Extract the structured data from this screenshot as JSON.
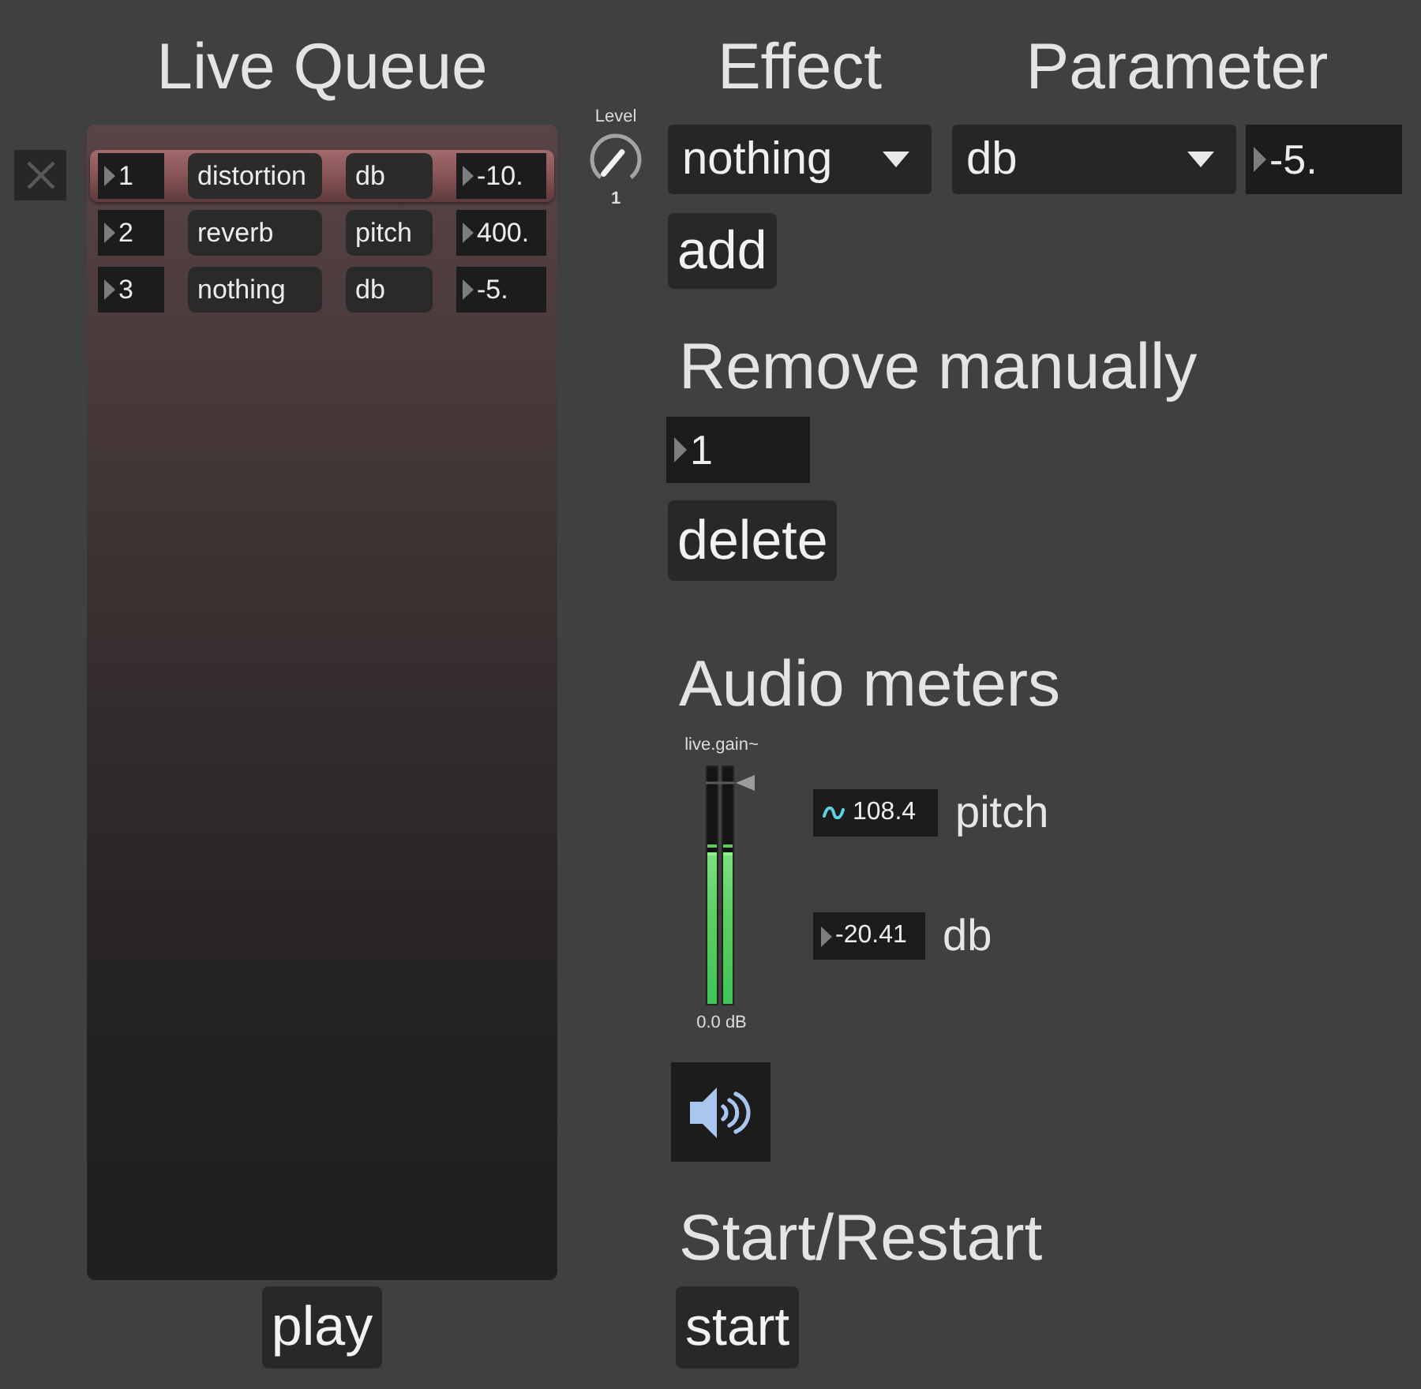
{
  "queue": {
    "title": "Live Queue",
    "rows": [
      {
        "index": "1",
        "effect": "distortion",
        "parameter": "db",
        "value": "-10.",
        "selected": true
      },
      {
        "index": "2",
        "effect": "reverb",
        "parameter": "pitch",
        "value": "400.",
        "selected": false
      },
      {
        "index": "3",
        "effect": "nothing",
        "parameter": "db",
        "value": "-5.",
        "selected": false
      }
    ],
    "play_button": "play"
  },
  "level_dial": {
    "label": "Level",
    "value": "1"
  },
  "add_effect": {
    "effect_heading": "Effect",
    "parameter_heading": "Parameter",
    "effect": "nothing",
    "parameter": "db",
    "value": "-5.",
    "button": "add"
  },
  "remove": {
    "heading": "Remove manually",
    "index": "1",
    "button": "delete"
  },
  "audio_meters": {
    "heading": "Audio meters",
    "gain": {
      "label": "live.gain~",
      "reading": "0.0 dB",
      "level": 0.93,
      "channels": [
        {
          "level": 0.64
        },
        {
          "level": 0.64
        }
      ]
    },
    "readouts": [
      {
        "kind": "signal",
        "value": "108.4",
        "label": "pitch"
      },
      {
        "kind": "number",
        "value": "-20.41",
        "label": "db"
      }
    ]
  },
  "start": {
    "heading": "Start/Restart",
    "button": "start"
  }
}
